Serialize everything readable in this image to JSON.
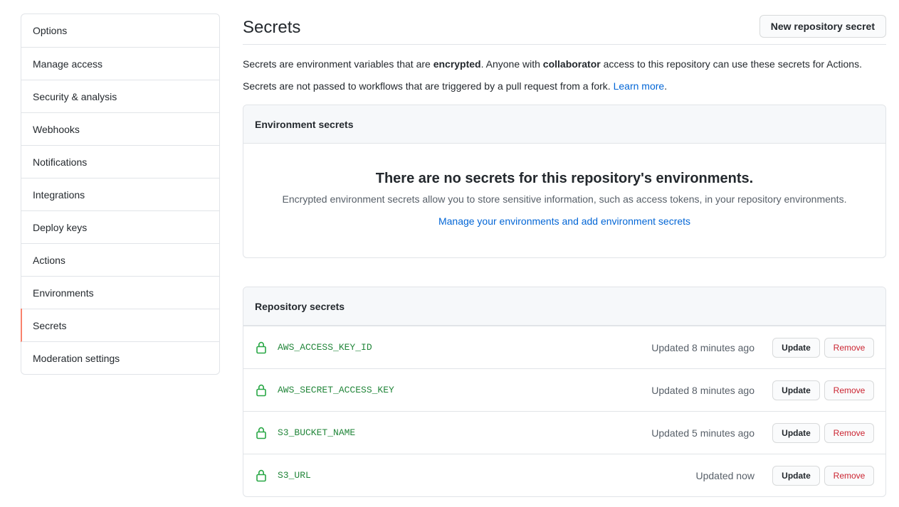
{
  "sidebar": {
    "items": [
      {
        "label": "Options"
      },
      {
        "label": "Manage access"
      },
      {
        "label": "Security & analysis"
      },
      {
        "label": "Webhooks"
      },
      {
        "label": "Notifications"
      },
      {
        "label": "Integrations"
      },
      {
        "label": "Deploy keys"
      },
      {
        "label": "Actions"
      },
      {
        "label": "Environments"
      },
      {
        "label": "Secrets",
        "selected": true
      },
      {
        "label": "Moderation settings"
      }
    ],
    "selected_accent": "#f9826c"
  },
  "main": {
    "title": "Secrets",
    "new_secret_label": "New repository secret",
    "desc1": {
      "part1": "Secrets are environment variables that are ",
      "bold1": "encrypted",
      "part2": ". Anyone with ",
      "bold2": "collaborator",
      "part3": " access to this repository can use these secrets for Actions."
    },
    "desc2": {
      "text": "Secrets are not passed to workflows that are triggered by a pull request from a fork. ",
      "link": "Learn more",
      "suffix": "."
    },
    "environment_secrets": {
      "header": "Environment secrets",
      "blank_title": "There are no secrets for this repository's environments.",
      "blank_desc": "Encrypted environment secrets allow you to store sensitive information, such as access tokens, in your repository environments.",
      "blank_link": "Manage your environments and add environment secrets"
    },
    "repository_secrets": {
      "header": "Repository secrets",
      "update_label": "Update",
      "remove_label": "Remove",
      "rows": [
        {
          "name": "AWS_ACCESS_KEY_ID",
          "updated": "Updated 8 minutes ago"
        },
        {
          "name": "AWS_SECRET_ACCESS_KEY",
          "updated": "Updated 8 minutes ago"
        },
        {
          "name": "S3_BUCKET_NAME",
          "updated": "Updated 5 minutes ago"
        },
        {
          "name": "S3_URL",
          "updated": "Updated now"
        }
      ]
    }
  },
  "colors": {
    "link": "#0366d6",
    "secret_name": "#22863a",
    "remove": "#cb2431"
  }
}
